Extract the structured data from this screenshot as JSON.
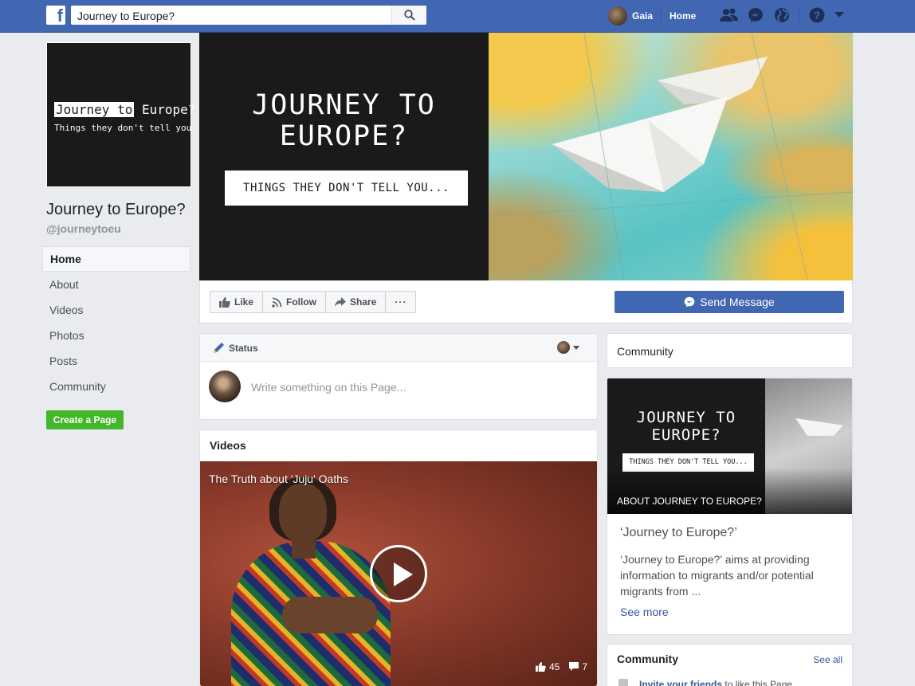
{
  "topbar": {
    "logo": "f",
    "search_value": "Journey to Europe?",
    "user_name": "Gaia",
    "home_label": "Home",
    "icons": [
      "facebook-logo-icon",
      "search-icon",
      "friend-requests-icon",
      "messenger-icon",
      "notifications-globe-icon",
      "help-icon",
      "account-menu-chevron-icon"
    ]
  },
  "page": {
    "name": "Journey to Europe?",
    "handle": "@journeytoeu",
    "profile_line1_boxed": "Journey to",
    "profile_line1_rest": " Europe?",
    "profile_line2": "Things they don't tell you..."
  },
  "left_nav": {
    "items": [
      {
        "label": "Home",
        "active": true
      },
      {
        "label": "About"
      },
      {
        "label": "Videos"
      },
      {
        "label": "Photos"
      },
      {
        "label": "Posts"
      },
      {
        "label": "Community"
      }
    ],
    "create_page": "Create a Page"
  },
  "cover": {
    "title_line1": "JOURNEY TO",
    "title_line2": "EUROPE?",
    "subtitle": "THINGS THEY DON'T TELL YOU..."
  },
  "actions": {
    "like": "Like",
    "follow": "Follow",
    "share": "Share",
    "more": "···",
    "send_message": "Send Message"
  },
  "composer": {
    "tab_label": "Status",
    "placeholder": "Write something on this Page..."
  },
  "videos": {
    "header": "Videos",
    "video_title": "The Truth about 'Juju' Oaths",
    "likes": "45",
    "comments": "7"
  },
  "right": {
    "community_top": "Community",
    "about_img_title1": "JOURNEY TO",
    "about_img_title2": "EUROPE?",
    "about_img_sub": "THINGS THEY DON'T TELL YOU...",
    "about_img_label": "ABOUT JOURNEY TO EUROPE?",
    "about_name": "‘Journey to Europe?’",
    "about_desc": "‘Journey to Europe?’ aims at providing information to migrants and/or potential migrants from ...",
    "see_more": "See more",
    "community_title": "Community",
    "see_all": "See all",
    "invite_link": "Invite your friends",
    "invite_rest": " to like this Page"
  },
  "colors": {
    "brand_blue": "#4267b2",
    "link_blue": "#365899",
    "create_green": "#42b72a",
    "background": "#e9ebee"
  }
}
